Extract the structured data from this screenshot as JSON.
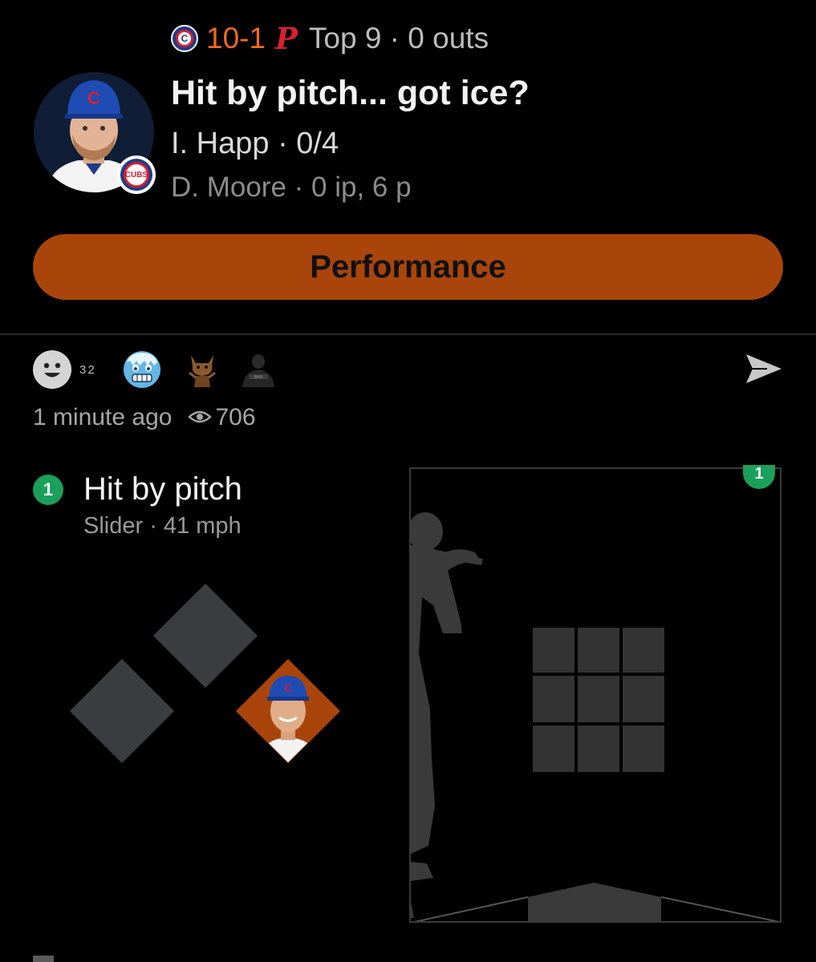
{
  "score_line": {
    "score": "10-1",
    "inning": "Top 9 · 0 outs",
    "home_logo_letter": "C",
    "away_logo_letter": "P"
  },
  "headline": "Hit by pitch... got ice?",
  "batter_line": "I. Happ · 0/4",
  "pitcher_line": "D. Moore · 0 ip, 6 p",
  "badge_text": "CUBS",
  "performance_button": "Performance",
  "reactions": {
    "count": "32"
  },
  "meta": {
    "time_ago": "1 minute ago",
    "views": "706"
  },
  "pitch": {
    "number": "1",
    "result": "Hit by pitch",
    "detail": "Slider · 41 mph"
  },
  "colors": {
    "accent_orange": "#a9450b",
    "score_orange": "#f06a1f",
    "pitch_green": "#1aa05a",
    "cubs_blue": "#1e3a8a",
    "cubs_red": "#d6212f"
  }
}
